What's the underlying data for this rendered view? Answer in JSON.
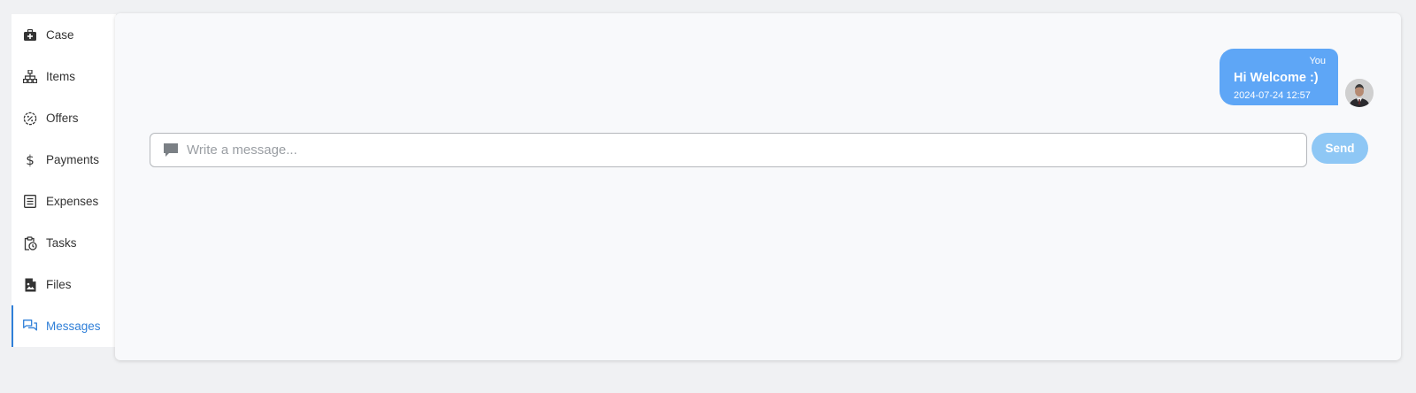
{
  "sidebar": {
    "items": [
      {
        "label": "Case",
        "icon": "medical-kit-icon",
        "active": false
      },
      {
        "label": "Items",
        "icon": "sitemap-icon",
        "active": false
      },
      {
        "label": "Offers",
        "icon": "percent-badge-icon",
        "active": false
      },
      {
        "label": "Payments",
        "icon": "dollar-icon",
        "active": false
      },
      {
        "label": "Expenses",
        "icon": "list-icon",
        "active": false
      },
      {
        "label": "Tasks",
        "icon": "clipboard-clock-icon",
        "active": false
      },
      {
        "label": "Files",
        "icon": "file-image-icon",
        "active": false
      },
      {
        "label": "Messages",
        "icon": "messages-icon",
        "active": true
      }
    ],
    "active_color": "#2f7fd8"
  },
  "messages": [
    {
      "sender": "You",
      "text": "Hi Welcome :)",
      "time": "2024-07-24 12:57",
      "bubble_color": "#5ea6f6"
    }
  ],
  "compose": {
    "placeholder": "Write a message...",
    "value": "",
    "icon": "comment-icon"
  },
  "send_button": {
    "label": "Send",
    "color": "#8ec7f5"
  }
}
